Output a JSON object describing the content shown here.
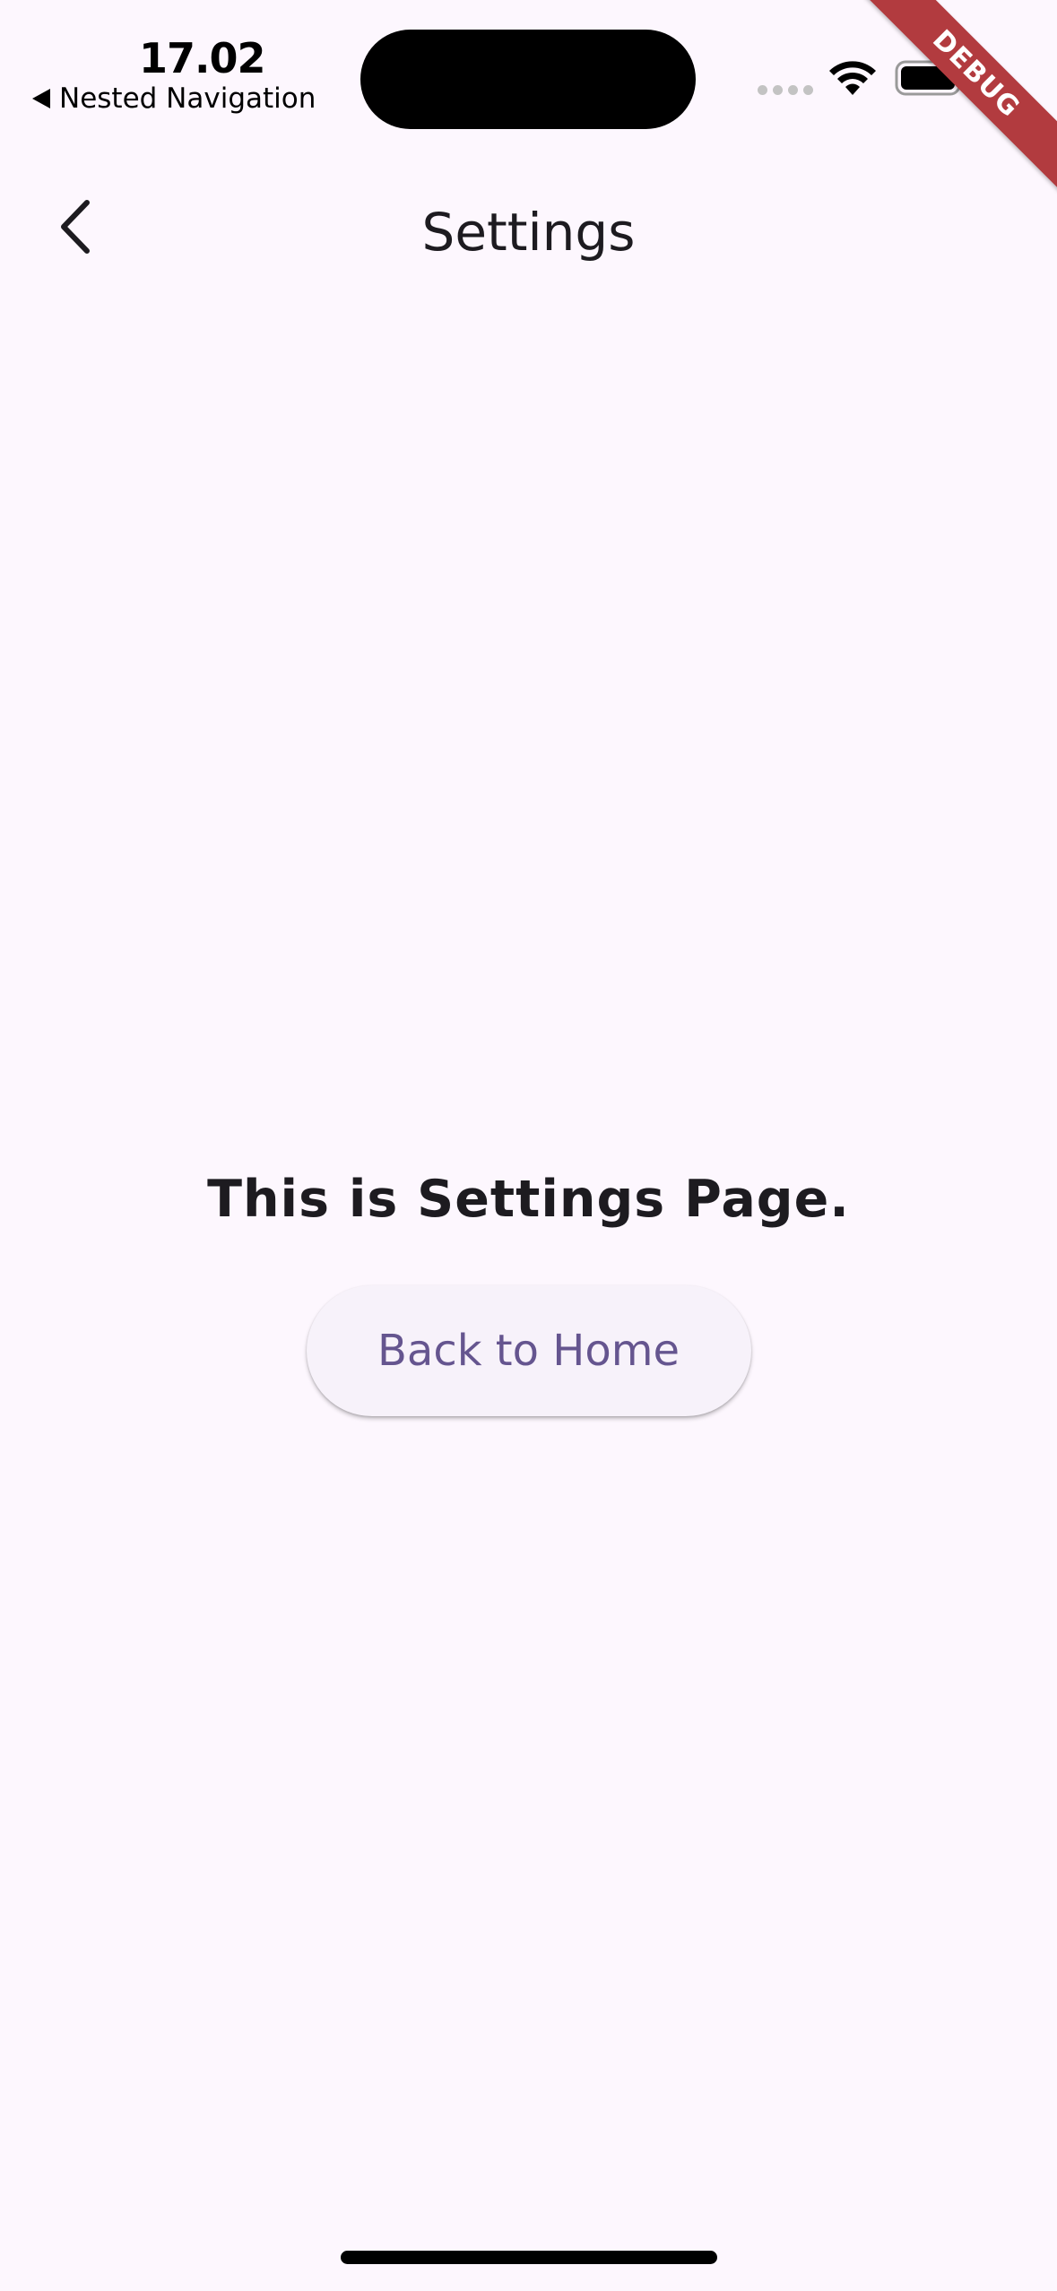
{
  "status_bar": {
    "time": "17.02",
    "back_app_label": "Nested Navigation"
  },
  "debug_banner": {
    "label": "DEBUG"
  },
  "app_bar": {
    "title": "Settings",
    "back_icon": "chevron-left-icon"
  },
  "content": {
    "message": "This is Settings Page.",
    "back_button_label": "Back to Home"
  },
  "colors": {
    "background": "#fdf7fe",
    "button_text": "#65558f",
    "button_background": "#f7f2fa",
    "debug_banner": "#b23b3f"
  }
}
